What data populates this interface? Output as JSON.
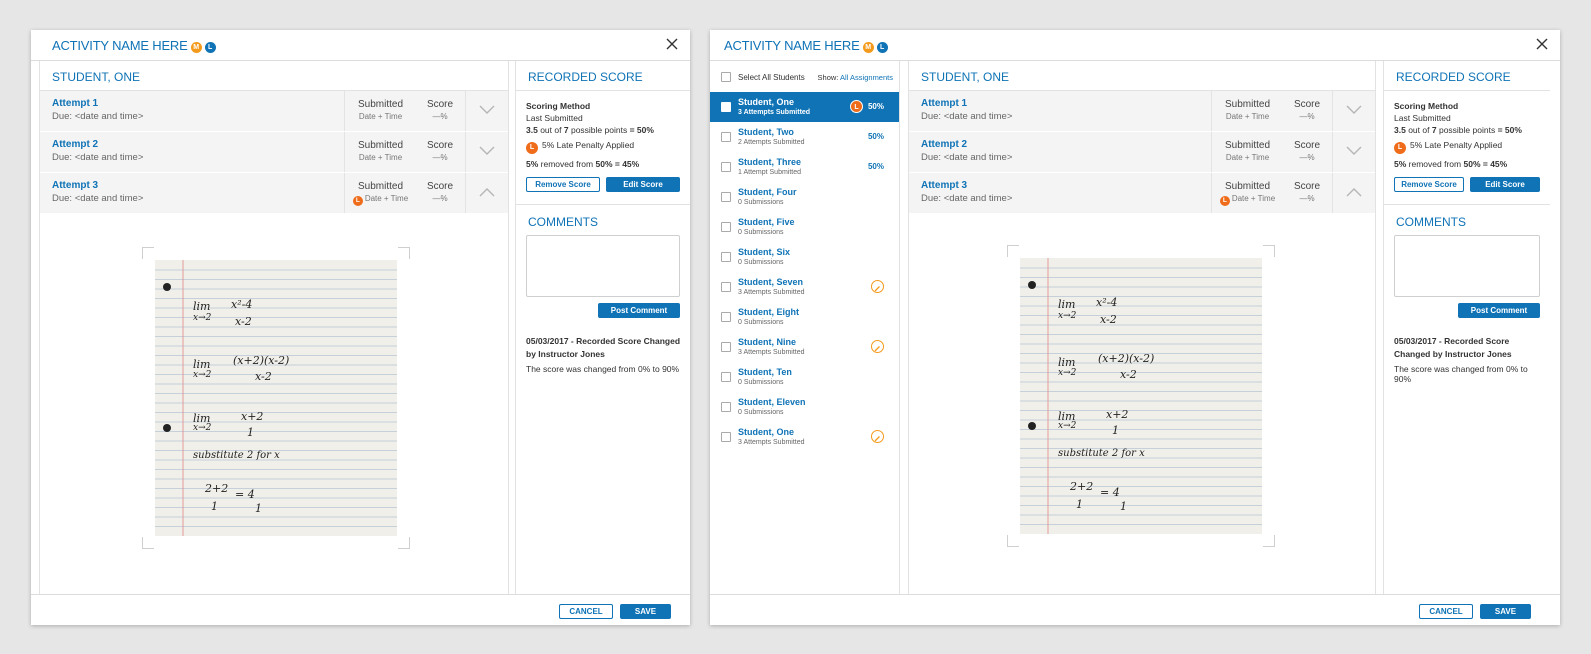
{
  "modal": {
    "title": "ACTIVITY NAME HERE",
    "badge_m": "M",
    "badge_l": "L",
    "cancel_label": "CANCEL",
    "save_label": "SAVE"
  },
  "student_panel": {
    "title": "STUDENT, ONE",
    "attempts": [
      {
        "name": "Attempt 1",
        "due": "Due: <date and time>",
        "status": "Submitted",
        "date": "Date + Time",
        "score_label": "Score",
        "score_value": "—%",
        "late": false,
        "expanded": false
      },
      {
        "name": "Attempt 2",
        "due": "Due: <date and time>",
        "status": "Submitted",
        "date": "Date + Time",
        "score_label": "Score",
        "score_value": "—%",
        "late": false,
        "expanded": false
      },
      {
        "name": "Attempt 3",
        "due": "Due: <date and time>",
        "status": "Submitted",
        "date": "Date + Time",
        "score_label": "Score",
        "score_value": "—%",
        "late": true,
        "late_badge": "L",
        "expanded": true
      }
    ],
    "handwriting": {
      "line1a": "lim",
      "line1b": "x→2",
      "line1c": "x²-4",
      "line1d": "x-2",
      "line2a": "lim",
      "line2b": "x→2",
      "line2c": "(x+2)(x-2)",
      "line2d": "x-2",
      "line3a": "lim",
      "line3b": "x→2",
      "line3c": "x+2",
      "line3d": "1",
      "line4": "substitute 2 for x",
      "line5a": "2+2",
      "line5b": "1",
      "line5c": "= 4",
      "line5d": "1"
    }
  },
  "recorded_score": {
    "title": "RECORDED SCORE",
    "method_label": "Scoring Method",
    "last_submitted": "Last Submitted",
    "points_earned": "3.5",
    "points_out_of": "out of",
    "points_total": "7",
    "points_suffix": "possible points",
    "points_result": "= 50%",
    "penalty_badge": "L",
    "penalty_text": "5% Late Penalty Applied",
    "removed_pct": "5%",
    "removed_text": "removed from",
    "removed_from": "50%",
    "removed_result": "= 45%",
    "remove_label": "Remove Score",
    "edit_label": "Edit Score"
  },
  "comments": {
    "title": "COMMENTS",
    "post_label": "Post Comment",
    "log_title": "05/03/2017 - Recorded Score Changed by Instructor Jones",
    "log_text": "The score was changed from 0% to 90%"
  },
  "student_list": {
    "select_all": "Select All Students",
    "show_label": "Show:",
    "show_value": "All Assignments",
    "items": [
      {
        "name": "Student, One",
        "sub": "3 Attempts Submitted",
        "pct": "50%",
        "late": true,
        "late_badge": "L",
        "pencil": false,
        "active": true
      },
      {
        "name": "Student, Two",
        "sub": "2 Attempts Submitted",
        "pct": "50%",
        "late": false,
        "pencil": false,
        "active": false
      },
      {
        "name": "Student, Three",
        "sub": "1 Attempt Submitted",
        "pct": "50%",
        "late": false,
        "pencil": false,
        "active": false
      },
      {
        "name": "Student, Four",
        "sub": "0 Submissions",
        "pct": "",
        "late": false,
        "pencil": false,
        "active": false
      },
      {
        "name": "Student, Five",
        "sub": "0 Submissions",
        "pct": "",
        "late": false,
        "pencil": false,
        "active": false
      },
      {
        "name": "Student, Six",
        "sub": "0 Submissions",
        "pct": "",
        "late": false,
        "pencil": false,
        "active": false
      },
      {
        "name": "Student, Seven",
        "sub": "3 Attempts Submitted",
        "pct": "",
        "late": false,
        "pencil": true,
        "active": false
      },
      {
        "name": "Student, Eight",
        "sub": "0 Submissions",
        "pct": "",
        "late": false,
        "pencil": false,
        "active": false
      },
      {
        "name": "Student, Nine",
        "sub": "3 Attempts Submitted",
        "pct": "",
        "late": false,
        "pencil": true,
        "active": false
      },
      {
        "name": "Student, Ten",
        "sub": "0 Submissions",
        "pct": "",
        "late": false,
        "pencil": false,
        "active": false
      },
      {
        "name": "Student, Eleven",
        "sub": "0 Submissions",
        "pct": "",
        "late": false,
        "pencil": false,
        "active": false
      },
      {
        "name": "Student, One",
        "sub": "3 Attempts Submitted",
        "pct": "",
        "late": false,
        "pencil": true,
        "active": false
      }
    ]
  },
  "colors": {
    "accent": "#0f73b6",
    "late": "#ef6c1a",
    "mastery": "#f49a1c"
  }
}
